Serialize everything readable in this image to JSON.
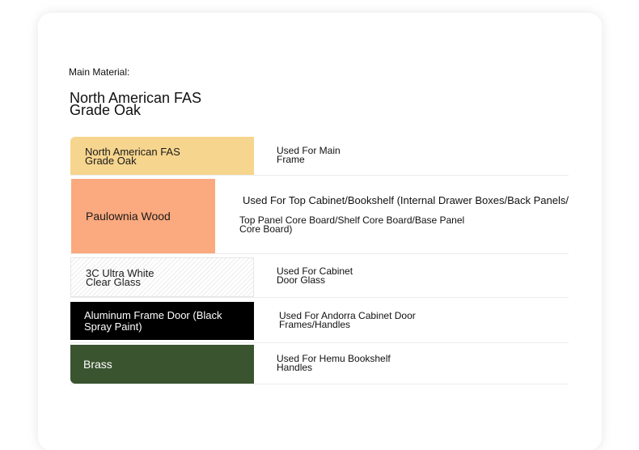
{
  "main": {
    "label": "Main Material:",
    "value": "North American FAS Grade Oak"
  },
  "materials": [
    {
      "name": "North American FAS Grade Oak",
      "use": "Used For Main Frame",
      "color": "#f6d58e"
    },
    {
      "name": "Paulownia Wood",
      "use_line1": "Used For Top Cabinet/Bookshelf (Internal Drawer Boxes/Back Panels/",
      "use_line2": "Top Panel Core Board/Shelf Core Board/Base Panel Core Board)",
      "color": "#fba97e"
    },
    {
      "name": "3C Ultra White Clear Glass",
      "use": "Used For Cabinet Door Glass",
      "color": "#ffffff"
    },
    {
      "name": "Aluminum Frame Door (Black Spray Paint)",
      "use": "Used For Andorra Cabinet Door Frames/Handles",
      "color": "#000000"
    },
    {
      "name": "Brass",
      "use": "Used For Hemu Bookshelf Handles",
      "color": "#3a5430"
    }
  ]
}
